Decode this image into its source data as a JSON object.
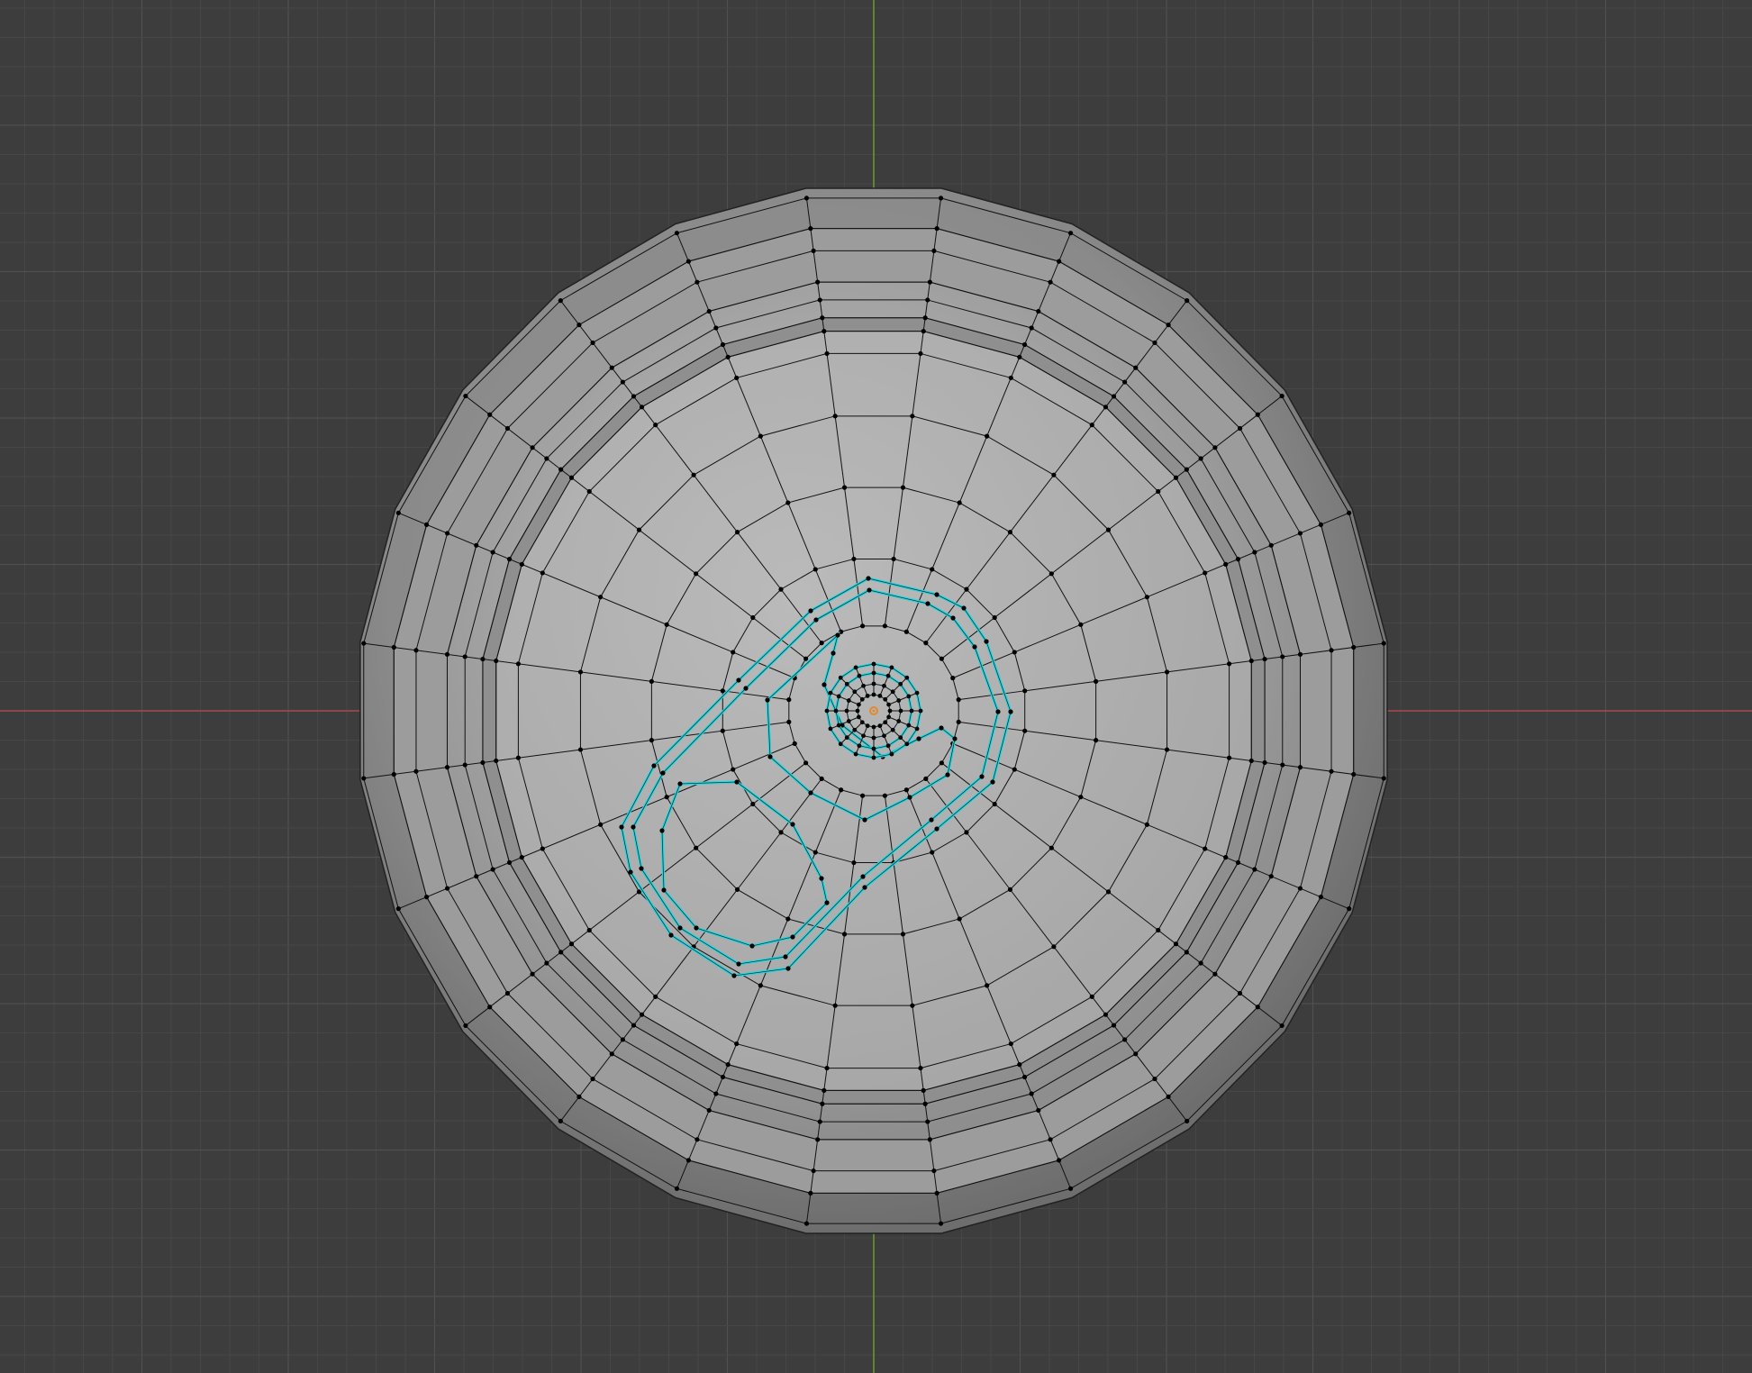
{
  "viewport": {
    "mode": "edit-mode",
    "view": "top-orthographic",
    "background_color": "#3d3d3d",
    "grid_minor_color": "#474747",
    "grid_major_color": "#505050",
    "x_axis_color": "#a8484f",
    "y_axis_color": "#6b9a2a"
  },
  "mesh": {
    "object": "can-top",
    "face_color": "#b4b4b4",
    "wire_color": "#111111",
    "vertex_color": "#000000",
    "selection_color": "#2bd3dc",
    "origin_color": "#e08a30"
  },
  "icons": [
    "object-origin-icon",
    "3d-cursor-icon"
  ]
}
